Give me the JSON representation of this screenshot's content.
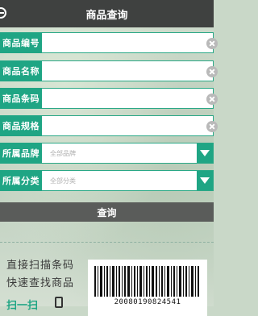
{
  "header": {
    "title": "商品查询"
  },
  "form": {
    "code_label": "商品编号",
    "name_label": "商品名称",
    "barcode_label": "商品条码",
    "spec_label": "商品规格",
    "brand_label": "所属品牌",
    "brand_placeholder": "全部品牌",
    "category_label": "所属分类",
    "category_placeholder": "全部分类"
  },
  "actions": {
    "query_label": "查询"
  },
  "scan_promo": {
    "line1": "直接扫描条码",
    "line2": "快速查找商品",
    "link_label": "扫一扫",
    "barcode_number": "20080190824541"
  },
  "colors": {
    "accent": "#1fa584",
    "header_bg": "#3f4140",
    "query_bg": "#5a5c5a"
  },
  "icons": {
    "back": "back-icon",
    "clear": "clear-icon",
    "dropdown": "triangle-down-icon",
    "phone": "phone-icon",
    "barcode": "barcode-icon"
  }
}
